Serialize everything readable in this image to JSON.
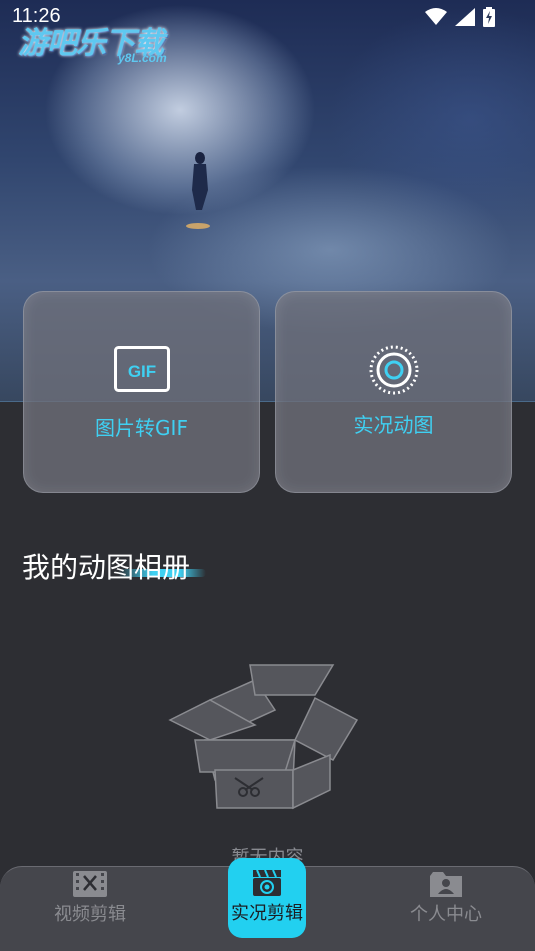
{
  "status_bar": {
    "time": "11:26"
  },
  "watermark": {
    "main": "游吧乐下载",
    "sub": "y8L.com"
  },
  "cards": [
    {
      "label": "图片转GIF",
      "icon": "gif-icon",
      "icon_text": "GIF"
    },
    {
      "label": "实况动图",
      "icon": "live-photo-icon"
    }
  ],
  "album": {
    "title": "我的动图相册",
    "empty_text": "暂无内容"
  },
  "bottom_nav": {
    "items": [
      {
        "label": "视频剪辑",
        "icon": "video-edit-icon",
        "active": false
      },
      {
        "label": "实况剪辑",
        "icon": "camera-icon",
        "active": true
      },
      {
        "label": "个人中心",
        "icon": "profile-icon",
        "active": false
      }
    ]
  },
  "colors": {
    "accent": "#22d0f0",
    "background": "#2d2e33",
    "nav_bg": "#45464c"
  }
}
